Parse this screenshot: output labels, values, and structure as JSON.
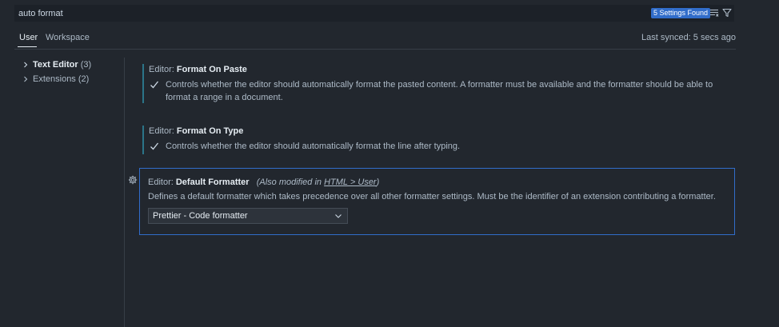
{
  "search": {
    "value": "auto format",
    "results_badge": "5 Settings Found"
  },
  "icons": {
    "clear_filter": "list-filter-icon",
    "filter": "funnel-icon",
    "chevron_right": "chevron-right-icon",
    "checkbox": "checkmark-icon",
    "gear": "gear-icon",
    "chevron_down": "chevron-down-icon"
  },
  "tabs": [
    {
      "label": "User",
      "active": true
    },
    {
      "label": "Workspace",
      "active": false
    }
  ],
  "sync_status": "Last synced: 5 secs ago",
  "toc": [
    {
      "label": "Text Editor",
      "count": "(3)",
      "bold": true
    },
    {
      "label": "Extensions",
      "count": "(2)",
      "bold": false
    }
  ],
  "settings": [
    {
      "category": "Editor: ",
      "key": "Format On Paste",
      "checked": true,
      "description": "Controls whether the editor should automatically format the pasted content. A formatter must be available and the formatter should be able to format a range in a document."
    },
    {
      "category": "Editor: ",
      "key": "Format On Type",
      "checked": true,
      "description": "Controls whether the editor should automatically format the line after typing."
    },
    {
      "category": "Editor: ",
      "key": "Default Formatter",
      "modified_prefix": "(Also modified in ",
      "modified_link": "HTML > User",
      "modified_suffix": ")",
      "description": "Defines a default formatter which takes precedence over all other formatter settings. Must be the identifier of an extension contributing a formatter.",
      "value": "Prettier - Code formatter"
    }
  ],
  "colors": {
    "background": "#22272e",
    "accent": "#316dca",
    "modified_indicator": "#2b7489"
  }
}
